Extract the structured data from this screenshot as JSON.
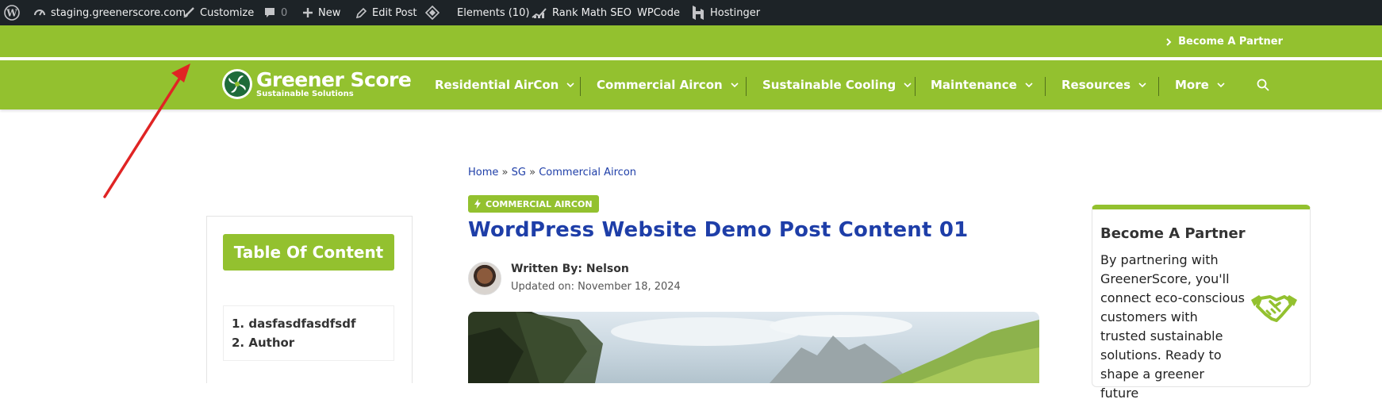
{
  "adminbar": {
    "site": "staging.greenerscore.com",
    "customize": "Customize",
    "comments_count": "0",
    "new": "New",
    "edit_post": "Edit Post",
    "elements": "Elements (10)",
    "rankmath": "Rank Math SEO",
    "wpcode": "WPCode",
    "hostinger": "Hostinger"
  },
  "topbar": {
    "partner_link": "Become A Partner"
  },
  "logo": {
    "name": "Greener Score",
    "tagline": "Sustainable Solutions"
  },
  "nav": {
    "items": [
      {
        "label": "Residential AirCon"
      },
      {
        "label": "Commercial Aircon"
      },
      {
        "label": "Sustainable Cooling"
      },
      {
        "label": "Maintenance"
      },
      {
        "label": "Resources"
      },
      {
        "label": "More"
      }
    ]
  },
  "toc": {
    "title": "Table Of Content",
    "items": [
      "1. dasfasdfasdfsdf",
      "2. Author"
    ]
  },
  "breadcrumb": {
    "items": [
      "Home",
      "SG",
      "Commercial Aircon"
    ],
    "separator": "»"
  },
  "post": {
    "category": "Commercial Aircon",
    "title": "WordPress Website Demo Post Content 01",
    "author": "Written By: Nelson",
    "updated": "Updated on: November 18, 2024"
  },
  "partner_card": {
    "heading": "Become A Partner",
    "text": "By partnering with GreenerScore, you'll connect eco-conscious customers with trusted sustainable solutions. Ready to shape a greener future"
  },
  "colors": {
    "brand_green": "#93c12f",
    "link_blue": "#1e3ea8",
    "admin_bar": "#1d2327",
    "arrow": "#e02424"
  }
}
